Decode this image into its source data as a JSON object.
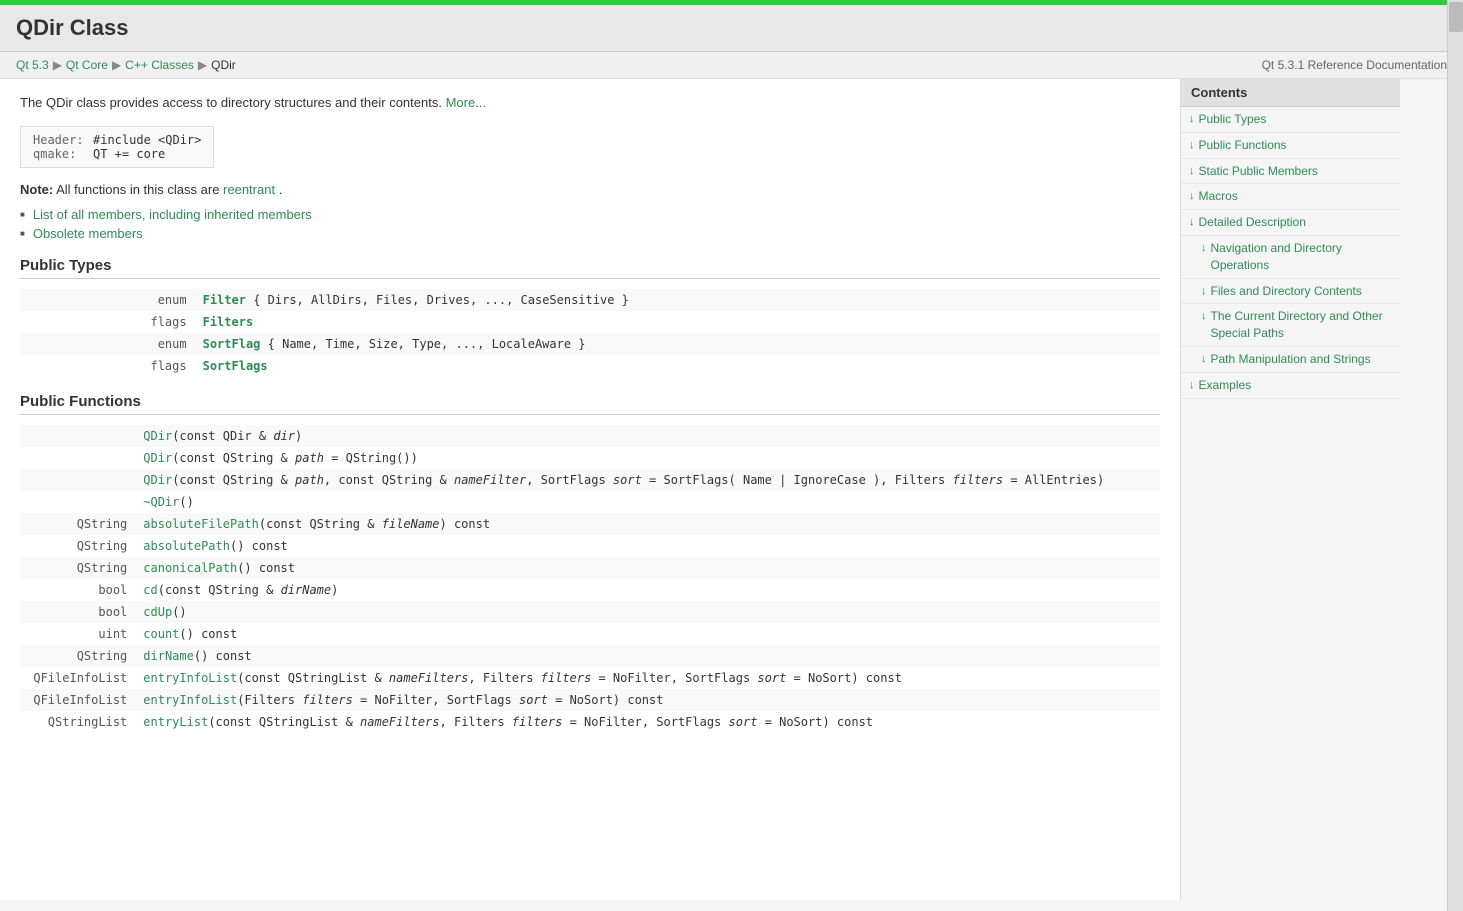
{
  "topbar": {
    "title": "QDir Class"
  },
  "breadcrumb": {
    "items": [
      "Qt 5.3",
      "Qt Core",
      "C++ Classes",
      "QDir"
    ],
    "right": "Qt 5.3.1 Reference Documentation"
  },
  "intro": {
    "text": "The QDir class provides access to directory structures and their contents.",
    "more_link": "More...",
    "header_label": "Header:",
    "header_value": "#include <QDir>",
    "qmake_label": "qmake:",
    "qmake_value": "QT += core"
  },
  "note": {
    "label": "Note:",
    "text": "All functions in this class are",
    "link_text": "reentrant",
    "end": "."
  },
  "links": [
    {
      "text": "List of all members, including inherited members"
    },
    {
      "text": "Obsolete members"
    }
  ],
  "sections": {
    "public_types": {
      "label": "Public Types",
      "rows": [
        {
          "keyword": "enum",
          "typename": "Filter",
          "rest": "{ Dirs, AllDirs, Files, Drives, ..., CaseSensitive }"
        },
        {
          "keyword": "flags",
          "typename": "Filters",
          "rest": ""
        },
        {
          "keyword": "enum",
          "typename": "SortFlag",
          "rest": "{ Name, Time, Size, Type, ..., LocaleAware }"
        },
        {
          "keyword": "flags",
          "typename": "SortFlags",
          "rest": ""
        }
      ]
    },
    "public_functions": {
      "label": "Public Functions",
      "rows": [
        {
          "type": "",
          "func": "QDir",
          "args": "(const QDir & dir)"
        },
        {
          "type": "",
          "func": "QDir",
          "args": "(const QString & path = QString())"
        },
        {
          "type": "",
          "func": "QDir",
          "args": "(const QString & path, const QString & nameFilter, SortFlags sort = SortFlags( Name | IgnoreCase ), Filters filters = AllEntries)"
        },
        {
          "type": "",
          "func": "~QDir",
          "args": "()"
        },
        {
          "type": "QString",
          "func": "absoluteFilePath",
          "args": "(const QString & fileName) const"
        },
        {
          "type": "QString",
          "func": "absolutePath",
          "args": "() const"
        },
        {
          "type": "QString",
          "func": "canonicalPath",
          "args": "() const"
        },
        {
          "type": "bool",
          "func": "cd",
          "args": "(const QString & dirName)"
        },
        {
          "type": "bool",
          "func": "cdUp",
          "args": "()"
        },
        {
          "type": "uint",
          "func": "count",
          "args": "() const"
        },
        {
          "type": "QString",
          "func": "dirName",
          "args": "() const"
        },
        {
          "type": "QFileInfoList",
          "func": "entryInfoList",
          "args": "(const QStringList & nameFilters, Filters filters = NoFilter, SortFlags sort = NoSort) const"
        },
        {
          "type": "QFileInfoList",
          "func": "entryInfoList",
          "args": "(Filters filters = NoFilter, SortFlags sort = NoSort) const"
        },
        {
          "type": "QStringList",
          "func": "entryList",
          "args": "(const QStringList & nameFilters, Filters filters = NoFilter, SortFlags sort = NoSort) const"
        }
      ]
    }
  },
  "sidebar": {
    "header": "Contents",
    "items": [
      {
        "label": "Public Types",
        "sub": false
      },
      {
        "label": "Public Functions",
        "sub": false
      },
      {
        "label": "Static Public Members",
        "sub": false
      },
      {
        "label": "Macros",
        "sub": false
      },
      {
        "label": "Detailed Description",
        "sub": false
      },
      {
        "label": "Navigation and Directory Operations",
        "sub": true
      },
      {
        "label": "Files and Directory Contents",
        "sub": true
      },
      {
        "label": "The Current Directory and Other Special Paths",
        "sub": true
      },
      {
        "label": "Path Manipulation and Strings",
        "sub": true
      },
      {
        "label": "Examples",
        "sub": false
      }
    ]
  }
}
